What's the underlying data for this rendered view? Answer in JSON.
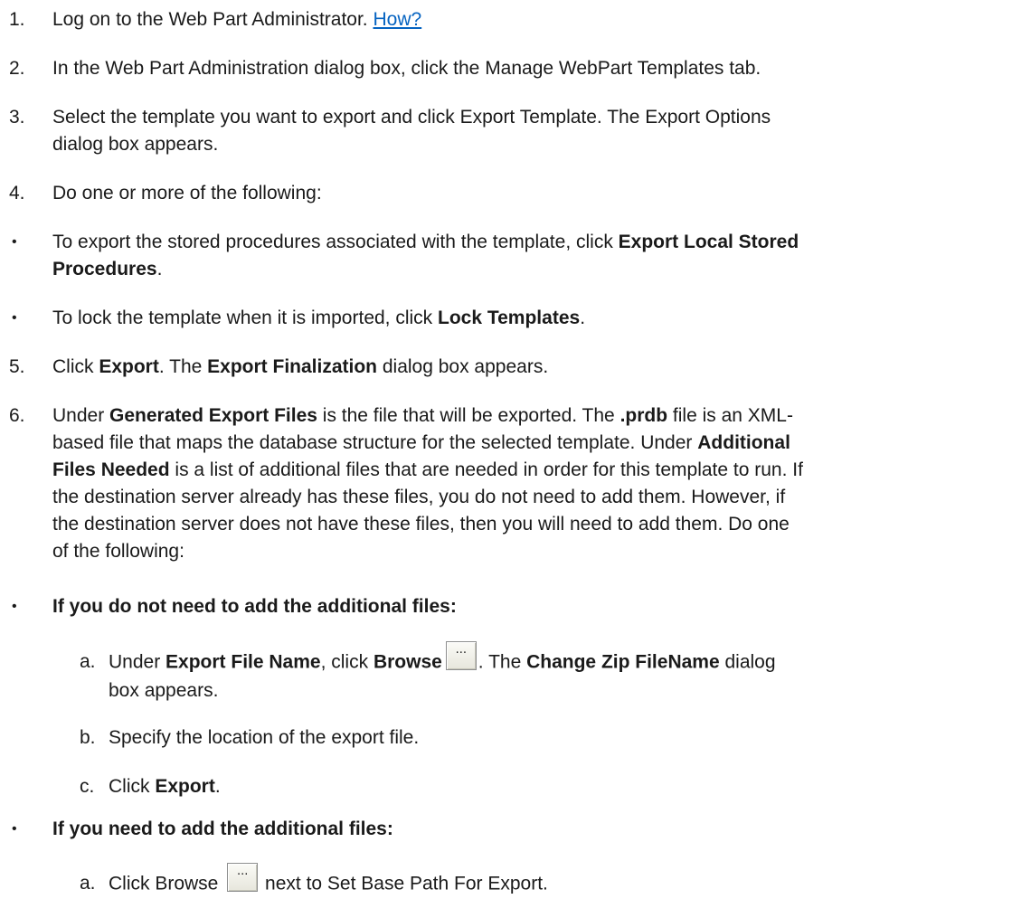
{
  "steps": [
    {
      "num": "1.",
      "text": "Log on to the Web Part Administrator. ",
      "link": "How?"
    },
    {
      "num": "2.",
      "text": "In the Web Part Administration dialog box, click the Manage WebPart Templates tab."
    },
    {
      "num": "3.",
      "line1": "Select the template you want to export and click Export Template. The Export Options",
      "line2": "dialog box appears."
    },
    {
      "num": "4.",
      "text": "Do one or more of the following:"
    },
    {
      "num": "5.",
      "t1": "Click ",
      "b1": "Export",
      "t2": ". The ",
      "b2": "Export Finalization",
      "t3": " dialog box appears."
    },
    {
      "num": "6."
    }
  ],
  "bullets": [
    {
      "symbol": "•",
      "t1": "To export the stored procedures associated with the template, click ",
      "b1": "Export Local Stored",
      "b2": "Procedures",
      "t2": "."
    },
    {
      "symbol": "•",
      "t1": "To lock the template when it is imported, click ",
      "b1": "Lock Templates",
      "t2": "."
    },
    {
      "symbol": "•",
      "heading": "If you do not need to add the additional files:"
    },
    {
      "symbol": "•",
      "heading": "If you need to add the additional files:"
    }
  ],
  "step6": {
    "l1a": "Under ",
    "l1b": "Generated Export Files",
    "l1c": " is the file that will be exported. The ",
    "l1d": ".prdb",
    "l1e": " file is an XML-",
    "l2a": "based file that maps the database structure for the selected template. Under ",
    "l2b": "Additional",
    "l3a": "Files Needed",
    "l3b": " is a list of additional files that are needed in order for this template to run. If",
    "l4": "the destination server already has these files, you do not need to add them. However, if",
    "l5": "the destination server does not have these files, then you will need to add them. Do one",
    "l6": "of the following:"
  },
  "subA": {
    "label": "a.",
    "t1": "Under ",
    "b1": "Export File Name",
    "t2": ", click ",
    "b2": "Browse",
    "t3": ". The ",
    "b3": "Change Zip FileName",
    "t4": " dialog",
    "line2": "box appears."
  },
  "subB": {
    "label": "b.",
    "text": "Specify the location of the export file."
  },
  "subC": {
    "label": "c.",
    "t1": "Click ",
    "b1": "Export",
    "t2": "."
  },
  "subA2": {
    "label": "a.",
    "t1": "Click Browse ",
    "t2": " next to Set Base Path For Export."
  },
  "browse_button": {
    "glyph": "..."
  }
}
